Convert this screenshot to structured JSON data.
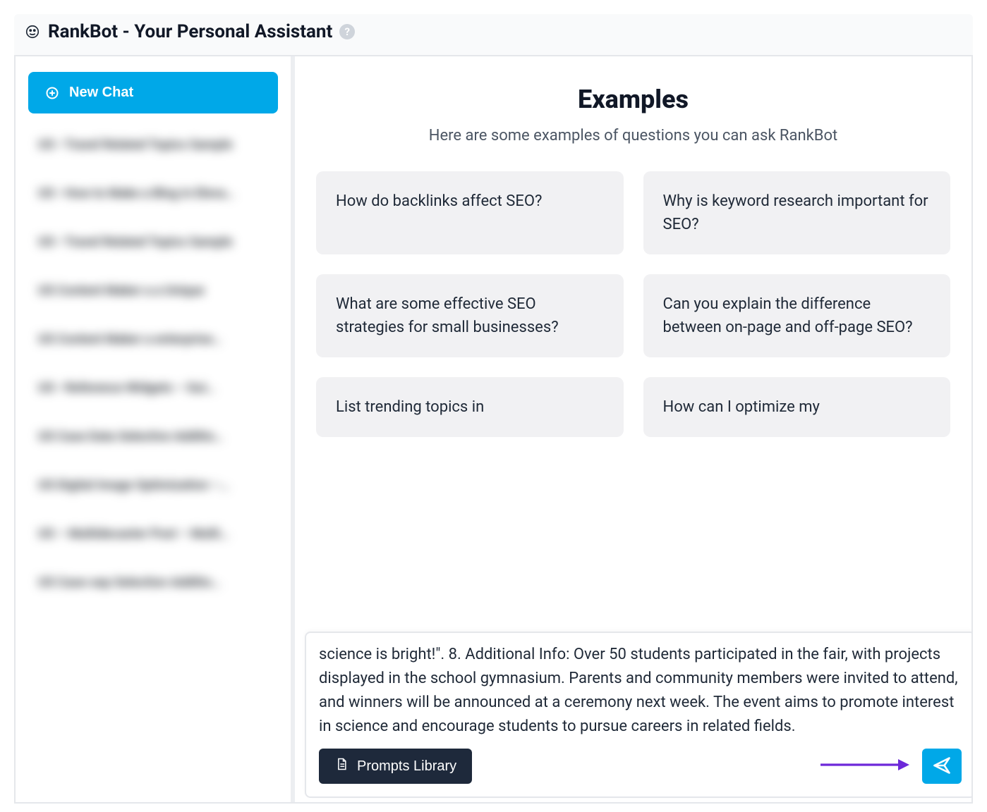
{
  "header": {
    "title": "RankBot - Your Personal Assistant"
  },
  "sidebar": {
    "new_chat_label": "New Chat",
    "history": [
      "US • Travel Related Topics Sample",
      "US • How to Make a Blog in Eleva…",
      "US • Travel Related Topics Sample",
      "US Content Maker a a Unique",
      "US Content Maker a enterprise…",
      "US • Reference Widgets – Gui…",
      "US Case Data Selective Additio…",
      "US Digital Image Optimization –…",
      "US – Multidecaster Post – Multi…",
      "US Case-sep Selection Additio…"
    ]
  },
  "main": {
    "heading": "Examples",
    "subheading": "Here are some examples of questions you can ask RankBot",
    "examples": [
      "How do backlinks affect SEO?",
      "Why is keyword research important for SEO?",
      "What are some effective SEO strategies for small businesses?",
      "Can you explain the difference between on-page and off-page SEO?",
      "List trending topics in",
      "How can I optimize my"
    ]
  },
  "composer": {
    "text": "science is bright!\".\n8. Additional Info: Over 50 students participated in the fair, with projects displayed in the school gymnasium. Parents and community members were invited to attend, and winners will be announced at a ceremony next week. The event aims to promote interest in science and encourage students to pursue careers in related fields.",
    "prompts_library_label": "Prompts Library"
  },
  "colors": {
    "accent": "#00a8e8",
    "dark_button": "#1e293b",
    "annotation": "#6d28d9"
  }
}
